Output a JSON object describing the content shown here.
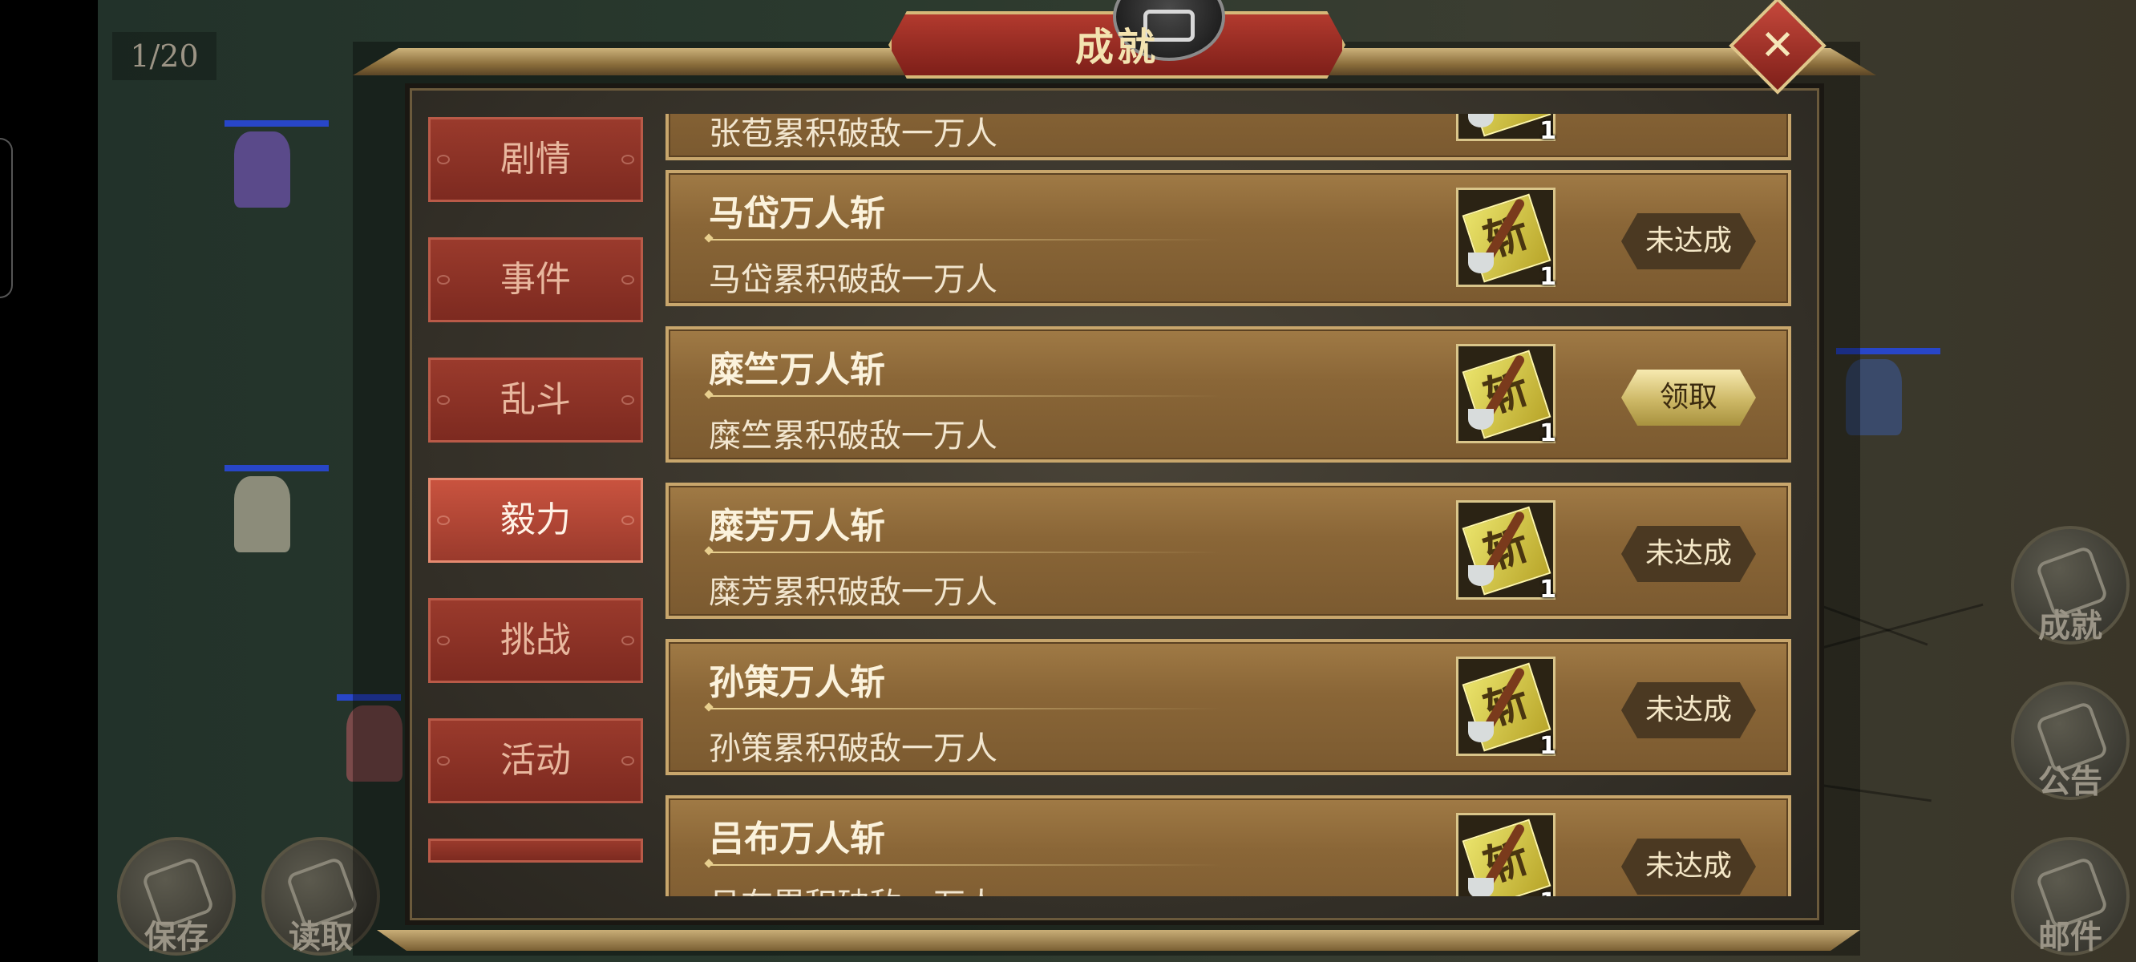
{
  "hud": {
    "page_counter": "1/20",
    "side_buttons": {
      "achievements": "成就",
      "notice": "公告",
      "mail": "邮件",
      "save": "保存",
      "load": "读取"
    }
  },
  "modal": {
    "title": "成就",
    "close_icon": "close-x-icon",
    "tabs": [
      {
        "label": "剧情",
        "active": false
      },
      {
        "label": "事件",
        "active": false
      },
      {
        "label": "乱斗",
        "active": false
      },
      {
        "label": "毅力",
        "active": true
      },
      {
        "label": "挑战",
        "active": false
      },
      {
        "label": "活动",
        "active": false
      }
    ],
    "achievements": [
      {
        "name": "",
        "desc": "张苞累积破敌一万人",
        "reward_count": "1",
        "status": ""
      },
      {
        "name": "马岱万人斩",
        "desc": "马岱累积破敌一万人",
        "reward_count": "1",
        "status": "未达成"
      },
      {
        "name": "糜竺万人斩",
        "desc": "糜竺累积破敌一万人",
        "reward_count": "1",
        "status": "领取"
      },
      {
        "name": "糜芳万人斩",
        "desc": "糜芳累积破敌一万人",
        "reward_count": "1",
        "status": "未达成"
      },
      {
        "name": "孙策万人斩",
        "desc": "孙策累积破敌一万人",
        "reward_count": "1",
        "status": "未达成"
      },
      {
        "name": "吕布万人斩",
        "desc": "吕布累积破敌一万人",
        "reward_count": "1",
        "status": "未达成"
      }
    ],
    "reward_icon_glyph": "斩"
  },
  "colors": {
    "tab_active": "#c9533f",
    "tab_inactive": "#9a3a2c",
    "row_bg": "#8a6637",
    "claim_button": "#cdb866",
    "pending_button": "#4b3922"
  }
}
